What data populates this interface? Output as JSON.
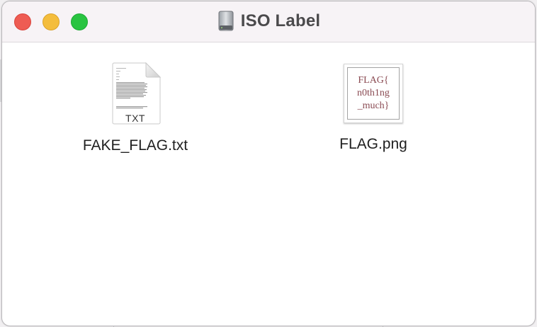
{
  "window": {
    "title": "ISO Label",
    "title_icon": "disk-icon",
    "controls": [
      "close",
      "minimize",
      "zoom"
    ]
  },
  "files": [
    {
      "name": "FAKE_FLAG.txt",
      "icon": "text-document-icon",
      "badge": "TXT"
    },
    {
      "name": "FLAG.png",
      "icon": "image-thumbnail",
      "preview_lines": [
        "FLAG{",
        "n0th1ng",
        "_much}"
      ]
    }
  ],
  "colors": {
    "close": "#ee5c53",
    "minimize": "#f4bd3c",
    "zoom": "#29c441",
    "titlebar": "#f7f3f6",
    "preview_text": "#8a4a52"
  }
}
